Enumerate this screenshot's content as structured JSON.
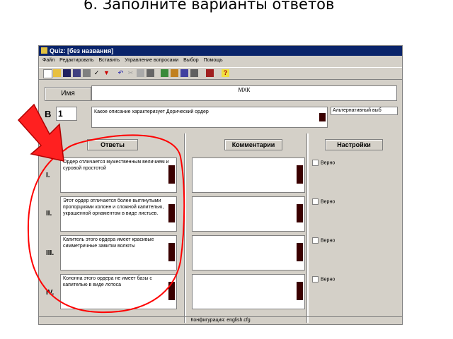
{
  "slide_title": "6. Заполните варианты ответов",
  "window": {
    "title": "Quiz: [без названия]"
  },
  "menu": [
    "Файл",
    "Редактировать",
    "Вставить",
    "Управление вопросами",
    "Выбор",
    "Помощь"
  ],
  "toolbar_icons": [
    "new-icon",
    "open-icon",
    "save-icon",
    "save-as-icon",
    "print-icon",
    "check-icon",
    "down-arrow-icon",
    "back-icon",
    "cut-icon",
    "copy-icon",
    "paste-icon",
    "table-icon",
    "chart-icon",
    "people-icon",
    "tools-icon",
    "window-icon",
    "help-icon"
  ],
  "name_label": "Имя",
  "name_value": "МХК",
  "question_label": "В",
  "question_number": "1",
  "question_text": "Какое описание характеризует Дорический ордер",
  "question_type": "Альтернативный выб",
  "tabs": {
    "answers": "Ответы",
    "comments": "Комментарии",
    "settings": "Настройки"
  },
  "answers": [
    {
      "num": "I.",
      "text": "Ордер отличается мужественным величием и суровой простотой",
      "check_label": "Верно"
    },
    {
      "num": "II.",
      "text": "Этот ордер отличается более вытянутыми пропорциями колонн и сложной капителью, украшенной орнаментом в виде листьев.",
      "check_label": "Верно"
    },
    {
      "num": "III.",
      "text": "Капитель этого ордера имеет красивые симметричные завитки волюты",
      "check_label": "Верно"
    },
    {
      "num": "IV.",
      "text": "Колонна этого ордера не имеет базы с капителью в виде лотоса",
      "check_label": "Верно"
    }
  ],
  "status": "Конфигурация: english.cfg"
}
